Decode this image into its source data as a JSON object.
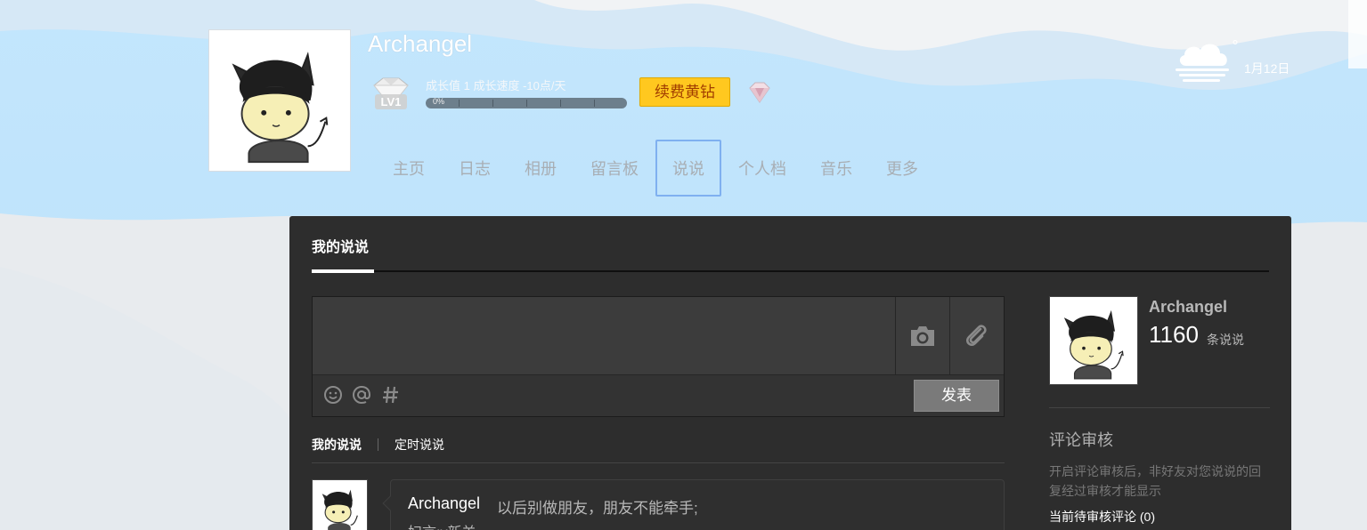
{
  "profile": {
    "username": "Archangel",
    "level": "LV1",
    "growth_label": "成长值 1   成长速度 -10点/天",
    "progress_text": "0%",
    "progress_fraction": 0.0,
    "renew_label": "续费黄钻"
  },
  "weather": {
    "icon": "cloud-fog-icon",
    "degree": "°",
    "date": "1月12日"
  },
  "nav": {
    "items": [
      {
        "label": "主页"
      },
      {
        "label": "日志"
      },
      {
        "label": "相册"
      },
      {
        "label": "留言板"
      },
      {
        "label": "说说",
        "active": true
      },
      {
        "label": "个人档"
      },
      {
        "label": "音乐"
      },
      {
        "label": "更多"
      }
    ]
  },
  "panel": {
    "title": "我的说说",
    "editor": {
      "value": "",
      "placeholder": "",
      "post_label": "发表"
    },
    "subtabs": [
      "我的说说",
      "定时说说"
    ],
    "feed": {
      "author": "Archangel",
      "content": "以后别做朋友，朋友不能牵手;",
      "content2": "妇言:γ新羊"
    },
    "sidebar": {
      "name": "Archangel",
      "count": "1160",
      "count_unit": "条说说",
      "review_title": "评论审核",
      "review_desc": "开启评论审核后，非好友对您说说的回复经过审核才能显示",
      "review_pending": "当前待审核评论 (0)"
    }
  },
  "colors": {
    "sky": "#bfe3fb",
    "panel": "#2d2d2d",
    "gold": "#ffc81f",
    "nav_active_border": "#7fb0f0"
  }
}
